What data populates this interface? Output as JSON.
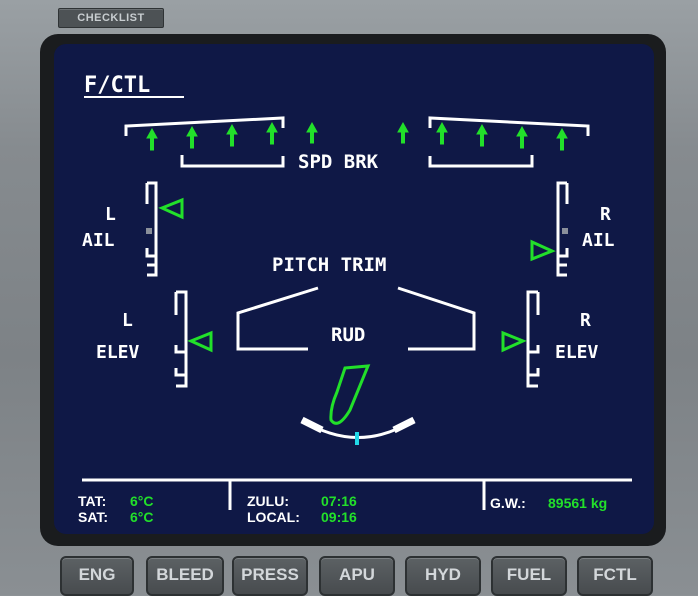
{
  "header": {
    "checklist_label": "CHECKLIST"
  },
  "page": {
    "title": "F/CTL"
  },
  "speed_brake": {
    "label": "SPD BRK"
  },
  "ailerons": {
    "left_top": "L",
    "left_bottom": "AIL",
    "right_top": "R",
    "right_bottom": "AIL"
  },
  "elevators": {
    "left_top": "L",
    "left_bottom": "ELEV",
    "right_top": "R",
    "right_bottom": "ELEV"
  },
  "pitch_trim": {
    "label": "PITCH TRIM"
  },
  "rudder": {
    "label": "RUD"
  },
  "footer": {
    "tat_label": "TAT:",
    "tat_value": "6°C",
    "sat_label": "SAT:",
    "sat_value": "6°C",
    "zulu_label": "ZULU:",
    "zulu_value": "07:16",
    "local_label": "LOCAL:",
    "local_value": "09:16",
    "gw_label": "G.W.:",
    "gw_value": "89561 kg"
  },
  "buttons": [
    "ENG",
    "BLEED",
    "PRESS",
    "APU",
    "HYD",
    "FUEL",
    "FCTL"
  ],
  "colors": {
    "screen_bg": "#0f1846",
    "indication_green": "#22e02a",
    "text_white": "#ffffff",
    "rudder_trim_cyan": "#22d8e8"
  },
  "icons": {
    "spoiler": "up-arrow-icon",
    "surface_pointer": "triangle-pointer-icon"
  }
}
